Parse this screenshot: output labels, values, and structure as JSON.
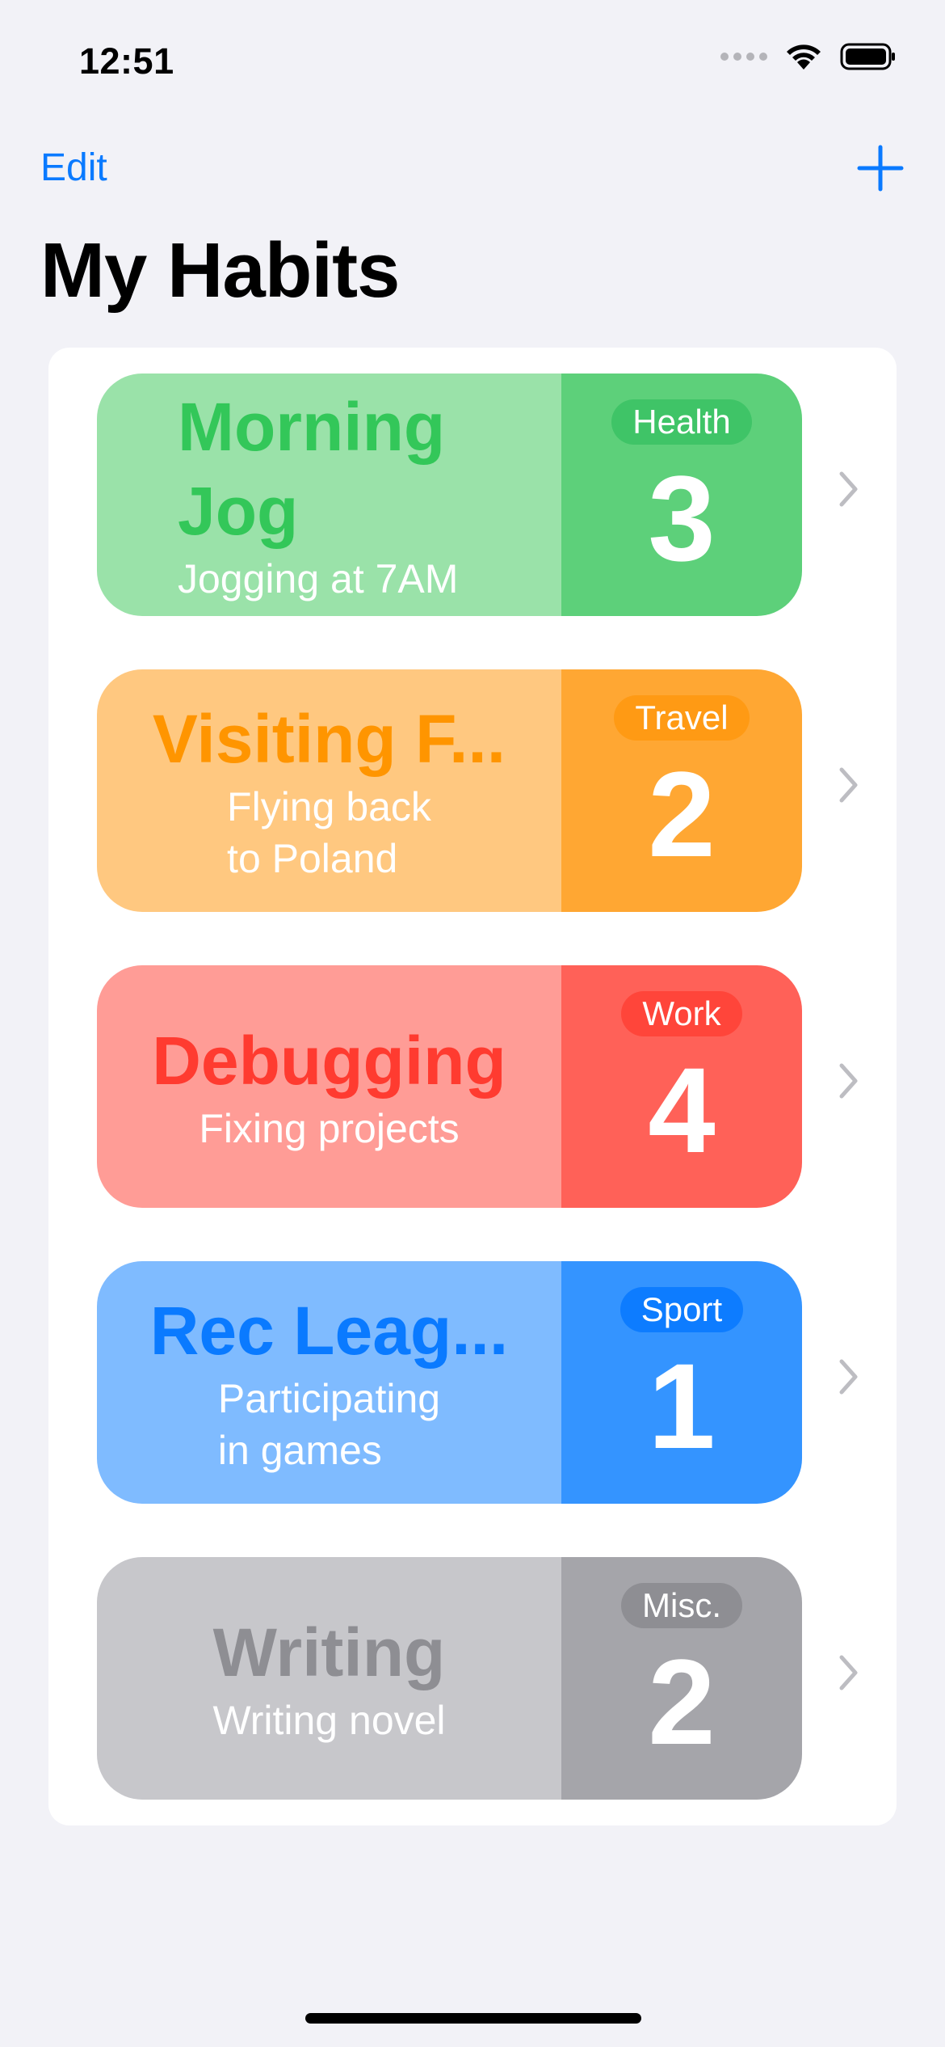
{
  "status_bar": {
    "time": "12:51"
  },
  "nav": {
    "edit_label": "Edit",
    "add_icon": "plus-icon"
  },
  "title": "My Habits",
  "colors": {
    "accent": "#0a7aff",
    "background": "#f2f2f7"
  },
  "habits": [
    {
      "title_lines": [
        "Morning",
        "Jog"
      ],
      "subtitle_lines": [
        "Jogging at 7AM"
      ],
      "category": "Health",
      "count": "3",
      "colors": {
        "light": "#9ae2a9",
        "dark": "#5dd07a",
        "title": "#33c759",
        "badge": "#3fc467"
      }
    },
    {
      "title_lines": [
        "Visiting F..."
      ],
      "subtitle_lines": [
        "Flying back",
        "to Poland"
      ],
      "category": "Travel",
      "count": "2",
      "colors": {
        "light": "#ffc880",
        "dark": "#ffa733",
        "title": "#ff9500",
        "badge": "#ff9a14"
      }
    },
    {
      "title_lines": [
        "Debugging"
      ],
      "subtitle_lines": [
        "Fixing projects"
      ],
      "category": "Work",
      "count": "4",
      "colors": {
        "light": "#ff9c96",
        "dark": "#ff6158",
        "title": "#ff3b30",
        "badge": "#ff453a"
      }
    },
    {
      "title_lines": [
        "Rec Leag..."
      ],
      "subtitle_lines": [
        "Participating",
        "in games"
      ],
      "category": "Sport",
      "count": "1",
      "colors": {
        "light": "#7fbbff",
        "dark": "#3494ff",
        "title": "#0a7aff",
        "badge": "#0d7cff"
      }
    },
    {
      "title_lines": [
        "Writing"
      ],
      "subtitle_lines": [
        "Writing novel"
      ],
      "category": "Misc.",
      "count": "2",
      "colors": {
        "light": "#c7c7cb",
        "dark": "#a5a5aa",
        "title": "#8e8e93",
        "badge": "#8e8e93"
      }
    }
  ]
}
